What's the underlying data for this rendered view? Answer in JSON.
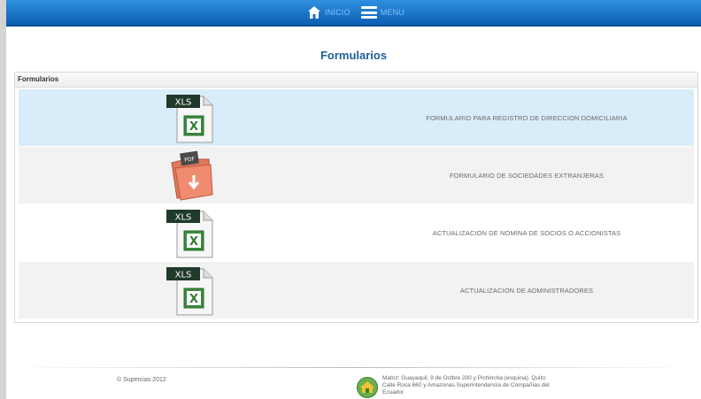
{
  "nav": {
    "home_label": "INICIO",
    "menu_label": "MENU"
  },
  "page": {
    "title": "Formularios"
  },
  "panel": {
    "header": "Formularios",
    "rows": [
      {
        "icon": "xls-file-icon",
        "label": "FORMULARIO PARA REGISTRO DE DIRECCION DOMICILIARIA",
        "state": "selected"
      },
      {
        "icon": "pdf-folder-icon",
        "label": "FORMULARIO DE SOCIEDADES EXTRANJERAS",
        "state": "alt"
      },
      {
        "icon": "xls-file-icon",
        "label": "ACTUALIZACION DE NOMINA DE SOCIOS O ACCIONISTAS",
        "state": "plain"
      },
      {
        "icon": "xls-file-icon",
        "label": "ACTUALIZACION DE ADMINISTRADORES",
        "state": "alt"
      }
    ],
    "xls_badge": "XLS",
    "pdf_badge": "PDF"
  },
  "footer": {
    "copyright": "© Supercias 2012",
    "address_line1": "Matriz: Guayaquil, 9 de Octbre 200 y Pichincha (esquina). Quito:",
    "address_line2": "Calle Roca 660 y Amazonas.Superintendencia de Compañías del",
    "address_line3": "Ecuador"
  },
  "colors": {
    "topbar": "#0d5fb3",
    "title": "#1f5f9a",
    "selected_row": "#d9ecfa",
    "alt_row": "#f2f2f2"
  }
}
